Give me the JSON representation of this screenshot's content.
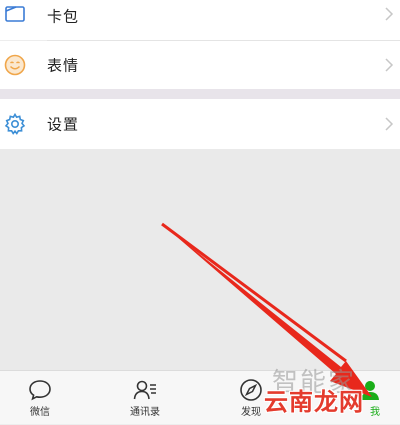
{
  "menu": {
    "items": [
      {
        "label": "卡包",
        "icon": "card-wallet-icon"
      },
      {
        "label": "表情",
        "icon": "smiley-icon"
      },
      {
        "label": "设置",
        "icon": "gear-icon"
      }
    ]
  },
  "tabbar": {
    "tabs": [
      {
        "label": "微信",
        "icon": "chat-bubble-icon"
      },
      {
        "label": "通讯录",
        "icon": "contacts-icon"
      },
      {
        "label": "发现",
        "icon": "compass-icon"
      },
      {
        "label": "我",
        "icon": "person-icon",
        "active": true
      }
    ]
  },
  "overlay": {
    "watermark_top": "智能家",
    "watermark_main": "云南龙网"
  },
  "colors": {
    "accent_green": "#1aad19",
    "arrow_red": "#e8281c",
    "card_icon_blue": "#3a7bd5",
    "smiley_orange": "#f0a64a",
    "gear_blue": "#3d8fd6"
  }
}
